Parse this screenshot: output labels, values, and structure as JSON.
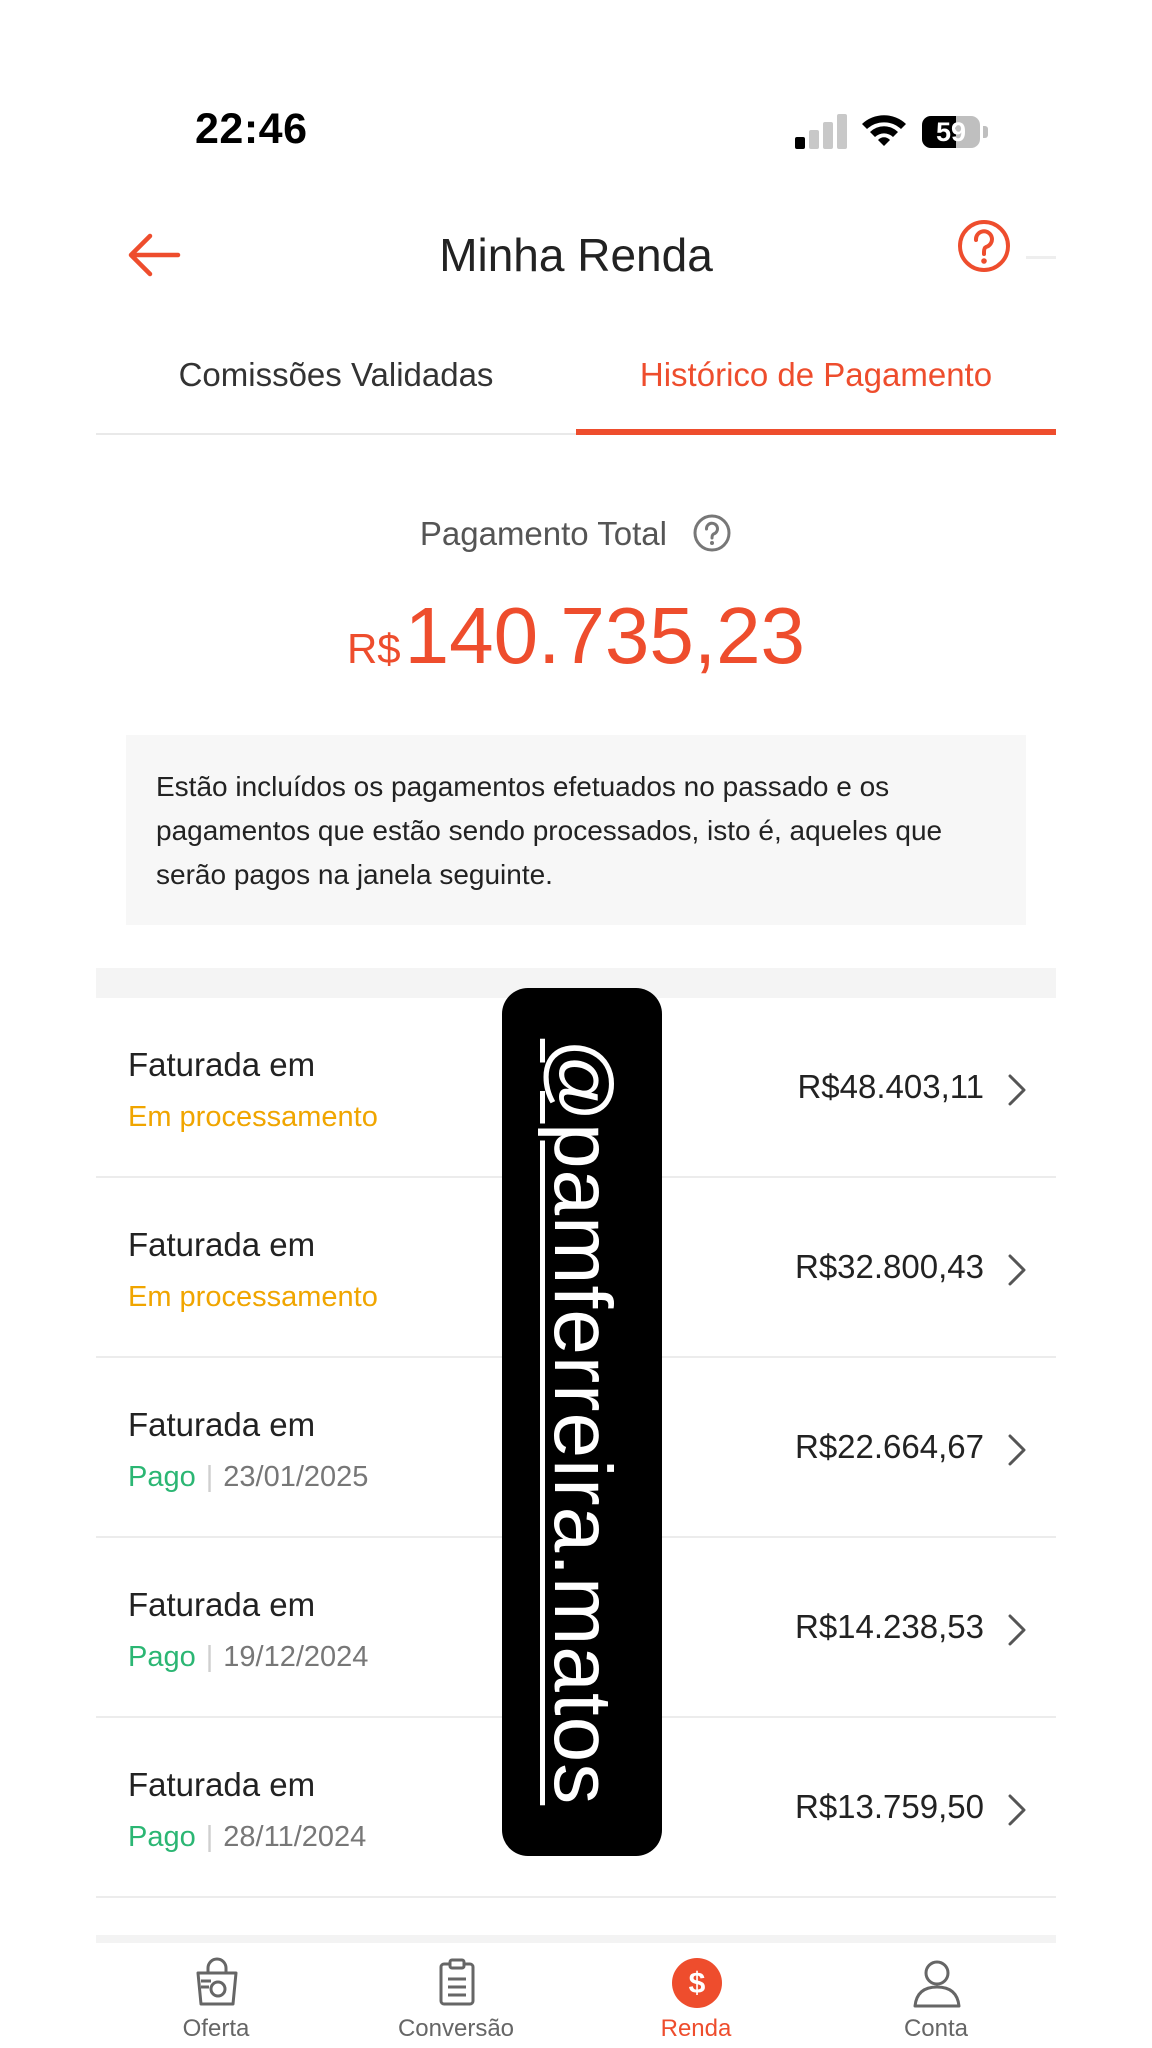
{
  "status_bar": {
    "time": "22:46",
    "battery": "59",
    "battery_level": 0.59
  },
  "header": {
    "title": "Minha Renda"
  },
  "tabs": [
    {
      "label": "Comissões Validadas",
      "active": false
    },
    {
      "label": "Histórico de Pagamento",
      "active": true
    }
  ],
  "summary": {
    "label": "Pagamento Total",
    "currency": "R$",
    "amount": "140.735,23",
    "info": "Estão incluídos os pagamentos efetuados no passado e os pagamentos que estão sendo processados, isto é, aqueles que serão pagos na janela seguinte."
  },
  "payments": [
    {
      "title": "Faturada em",
      "status": "Em processamento",
      "date": "",
      "amount": "R$48.403,11"
    },
    {
      "title": "Faturada em",
      "status": "Em processamento",
      "date": "",
      "amount": "R$32.800,43"
    },
    {
      "title": "Faturada em",
      "status": "Pago",
      "date": "23/01/2025",
      "amount": "R$22.664,67"
    },
    {
      "title": "Faturada em",
      "status": "Pago",
      "date": "19/12/2024",
      "amount": "R$14.238,53"
    },
    {
      "title": "Faturada em",
      "status": "Pago",
      "date": "28/11/2024",
      "amount": "R$13.759,50"
    }
  ],
  "watermark": "@pamferreira.matos",
  "bottom_nav": [
    {
      "label": "Oferta",
      "icon": "shopping-bag-icon",
      "active": false
    },
    {
      "label": "Conversão",
      "icon": "clipboard-icon",
      "active": false
    },
    {
      "label": "Renda",
      "icon": "dollar-circle-icon",
      "active": true
    },
    {
      "label": "Conta",
      "icon": "user-icon",
      "active": false
    }
  ],
  "colors": {
    "accent": "#ee4d2d",
    "processing": "#f0a500",
    "paid": "#2bb673"
  }
}
